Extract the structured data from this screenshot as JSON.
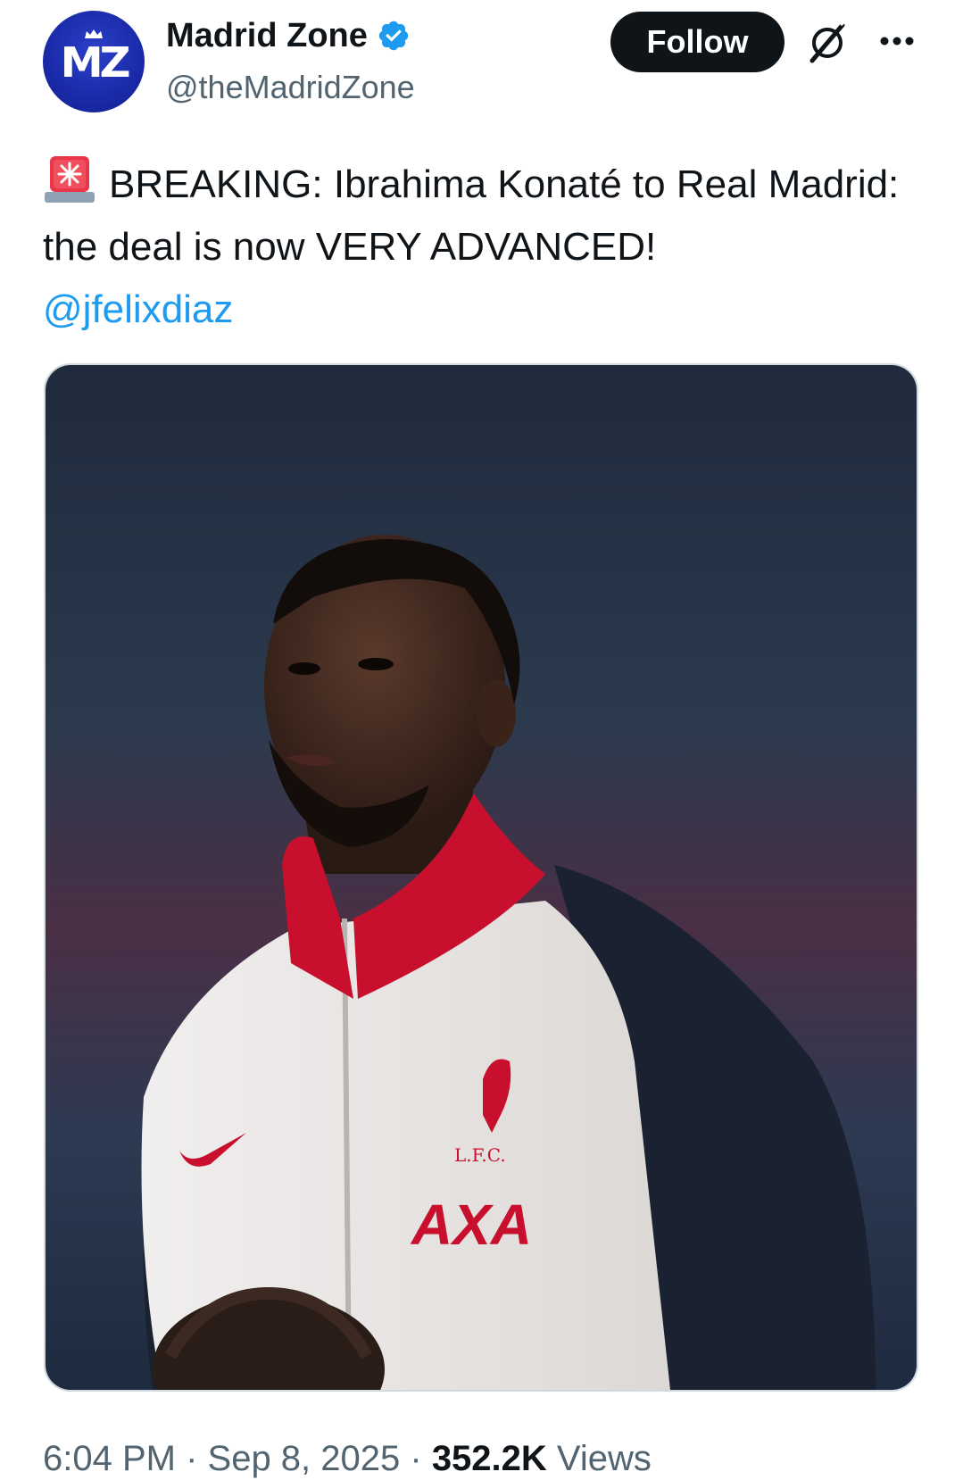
{
  "author": {
    "display_name": "Madrid Zone",
    "handle": "@theMadridZone",
    "avatar_text": "MZ",
    "verified": true
  },
  "actions": {
    "follow_label": "Follow",
    "grok_icon": "grok-icon",
    "more_icon": "more-options-icon"
  },
  "post": {
    "emoji": "siren-emoji",
    "text_line": "BREAKING: Ibrahima Konaté to Real Madrid: the deal is now VERY ADVANCED!",
    "mention": "@jfelixdiaz"
  },
  "media": {
    "kit_badge": "L.F.C.",
    "sponsor": "AXA"
  },
  "meta": {
    "time": "6:04 PM",
    "sep1": " · ",
    "date": "Sep 8, 2025",
    "sep2": " · ",
    "views_count": "352.2K",
    "views_label": " Views"
  },
  "colors": {
    "accent": "#1d9bf0",
    "text": "#0f1419",
    "secondary": "#536471",
    "follow_bg": "#0f1419"
  }
}
